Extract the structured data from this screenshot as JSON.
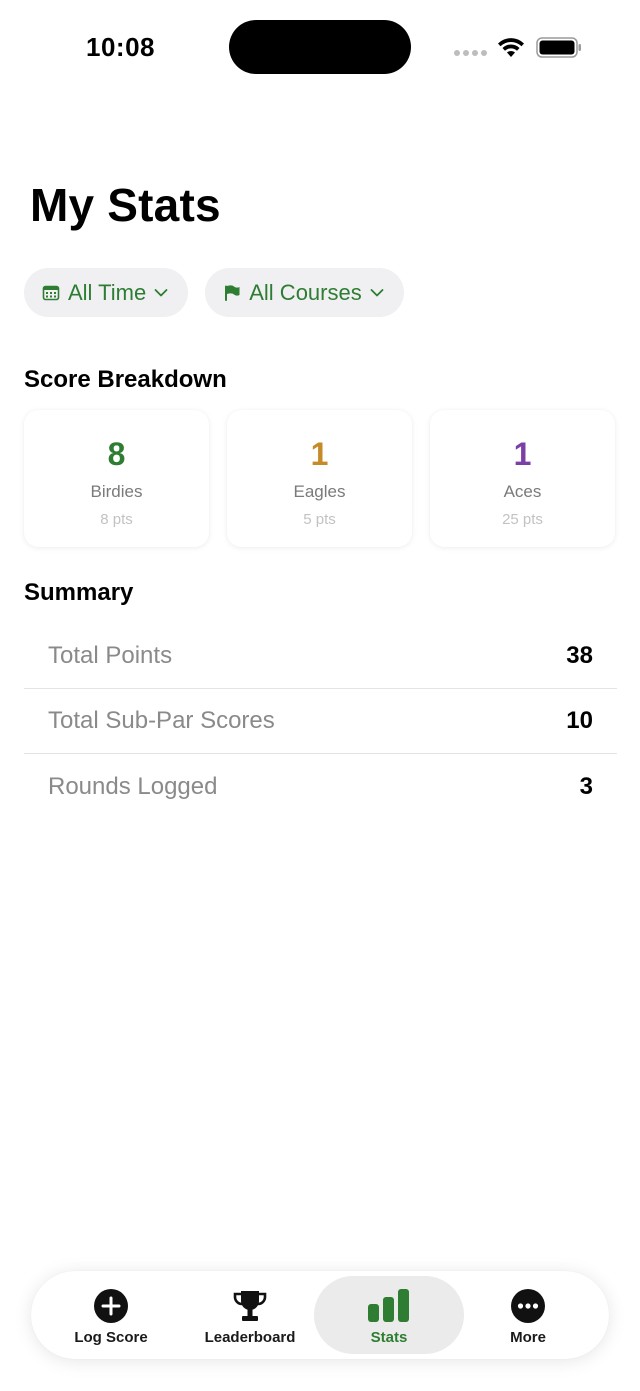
{
  "status_bar": {
    "time": "10:08"
  },
  "title": "My Stats",
  "filters": [
    {
      "label": "All Time",
      "icon": "calendar-icon"
    },
    {
      "label": "All Courses",
      "icon": "flag-icon"
    }
  ],
  "score_breakdown": {
    "heading": "Score Breakdown",
    "cards": [
      {
        "value": "8",
        "label": "Birdies",
        "pts": "8 pts",
        "color": "#2e7d32"
      },
      {
        "value": "1",
        "label": "Eagles",
        "pts": "5 pts",
        "color": "#c68a28"
      },
      {
        "value": "1",
        "label": "Aces",
        "pts": "25 pts",
        "color": "#7b3fa6"
      }
    ]
  },
  "summary": {
    "heading": "Summary",
    "rows": [
      {
        "label": "Total Points",
        "value": "38"
      },
      {
        "label": "Total Sub-Par Scores",
        "value": "10"
      },
      {
        "label": "Rounds Logged",
        "value": "3"
      }
    ]
  },
  "tabbar": {
    "tabs": [
      {
        "label": "Log Score",
        "icon": "plus-circle-icon"
      },
      {
        "label": "Leaderboard",
        "icon": "trophy-icon"
      },
      {
        "label": "Stats",
        "icon": "bar-chart-icon",
        "active": true
      },
      {
        "label": "More",
        "icon": "ellipsis-circle-icon"
      }
    ]
  },
  "colors": {
    "accent": "#2e7d32",
    "eagle": "#c68a28",
    "ace": "#7b3fa6"
  }
}
